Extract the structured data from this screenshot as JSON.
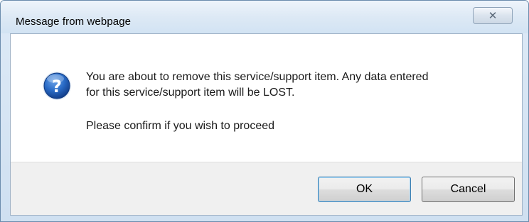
{
  "window": {
    "title": "Message from webpage",
    "close_glyph": "✕"
  },
  "dialog": {
    "icon": "question-icon",
    "message_line1": "You are about to remove this service/support item. Any data entered",
    "message_line2": "for this service/support item will be LOST.",
    "confirm_text": "Please confirm if you wish to proceed"
  },
  "buttons": {
    "ok_label": "OK",
    "cancel_label": "Cancel"
  },
  "colors": {
    "title_gradient_top": "#eef4fb",
    "title_gradient_bottom": "#d2e3f3",
    "footer_bg": "#f0f0f0",
    "icon_blue": "#1d5fb8",
    "default_button_border": "#3c7fb1"
  }
}
